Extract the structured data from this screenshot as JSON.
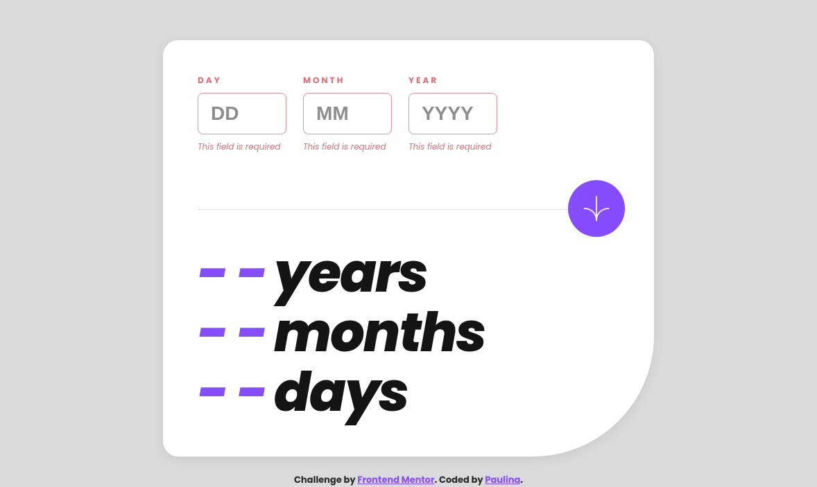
{
  "form": {
    "day": {
      "label": "DAY",
      "placeholder": "DD",
      "value": "",
      "error": "This field is required"
    },
    "month": {
      "label": "MONTH",
      "placeholder": "MM",
      "value": "",
      "error": "This field is required"
    },
    "year": {
      "label": "YEAR",
      "placeholder": "YYYY",
      "value": "",
      "error": "This field is required"
    }
  },
  "results": {
    "years": {
      "value": "- -",
      "label": "years"
    },
    "months": {
      "value": "- -",
      "label": "months"
    },
    "days": {
      "value": "- -",
      "label": "days"
    }
  },
  "attribution": {
    "prefix": "Challenge by ",
    "link1": "Frontend Mentor",
    "middle": ". Coded by ",
    "link2": "Paulina",
    "suffix": "."
  },
  "colors": {
    "accent": "#854dff",
    "error": "#e06d73",
    "bg": "#dbdbdb",
    "card": "#ffffff"
  }
}
